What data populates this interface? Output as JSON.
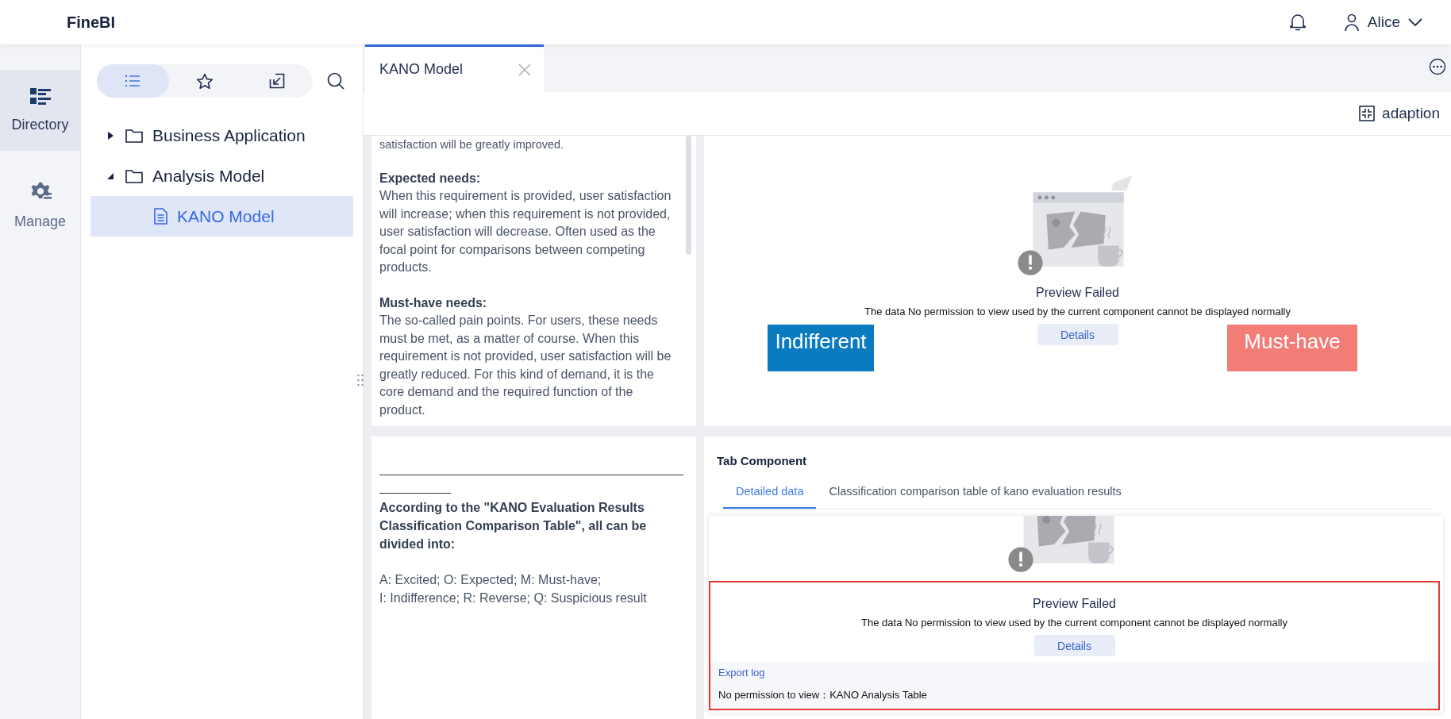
{
  "app": {
    "title": "FineBI"
  },
  "header": {
    "user": "Alice"
  },
  "nav": [
    {
      "kind": "directory",
      "label": "Directory",
      "selected": true
    },
    {
      "kind": "manage",
      "label": "Manage",
      "selected": false
    }
  ],
  "directory": {
    "view_tabs": [
      {
        "kind": "list",
        "selected": true
      },
      {
        "kind": "favorites",
        "selected": false
      },
      {
        "kind": "import",
        "selected": false
      }
    ],
    "tree": [
      {
        "kind": "folder",
        "label": "Business Application",
        "expanded": false,
        "selected": false
      },
      {
        "kind": "folder",
        "label": "Analysis Model",
        "expanded": true,
        "selected": false,
        "children": [
          {
            "kind": "report",
            "label": "KANO Model",
            "selected": true
          }
        ]
      }
    ]
  },
  "tabs": [
    {
      "label": "KANO Model",
      "selected": true
    }
  ],
  "toolbar": {
    "adaption": "adaption"
  },
  "text_panel": {
    "blocks": [
      {
        "text": "satisfaction will be greatly improved."
      },
      {
        "heading": "Expected needs:",
        "text": "When this requirement is provided, user satisfaction will increase; when this requirement is not provided, user satisfaction will decrease. Often used as the focal point for comparisons between competing products."
      },
      {
        "heading": "Must-have needs:",
        "text": "The so-called pain points. For users, these needs must be met, as a matter of course. When this requirement is not provided, user satisfaction will be greatly reduced. For this kind of demand, it is the core demand and the required function of the product."
      }
    ]
  },
  "preview": {
    "title": "Preview Failed",
    "message": "The data No permission to view used by the current component cannot be displayed normally",
    "button": "Details",
    "labels": [
      {
        "text": "Indifferent",
        "color": "#0a7bbf"
      },
      {
        "text": "Must-have",
        "color": "#f27c76"
      }
    ]
  },
  "note_panel": {
    "heading": "According to the \"KANO Evaluation Results Classification Comparison Table\", all can be divided into:",
    "lines": [
      "A: Excited; O: Expected; M: Must-have;",
      "I: Indifference; R: Reverse; Q: Suspicious result"
    ]
  },
  "tab_component": {
    "title": "Tab Component",
    "tabs": [
      {
        "label": "Detailed data",
        "selected": true
      },
      {
        "label": "Classification comparison table of kano evaluation results",
        "selected": false
      }
    ],
    "error": {
      "title": "Preview Failed",
      "message": "The data No permission to view used by the current component cannot be displayed normally",
      "button": "Details",
      "export_link": "Export log",
      "permission_text": "No permission to view：KANO Analysis Table"
    }
  }
}
